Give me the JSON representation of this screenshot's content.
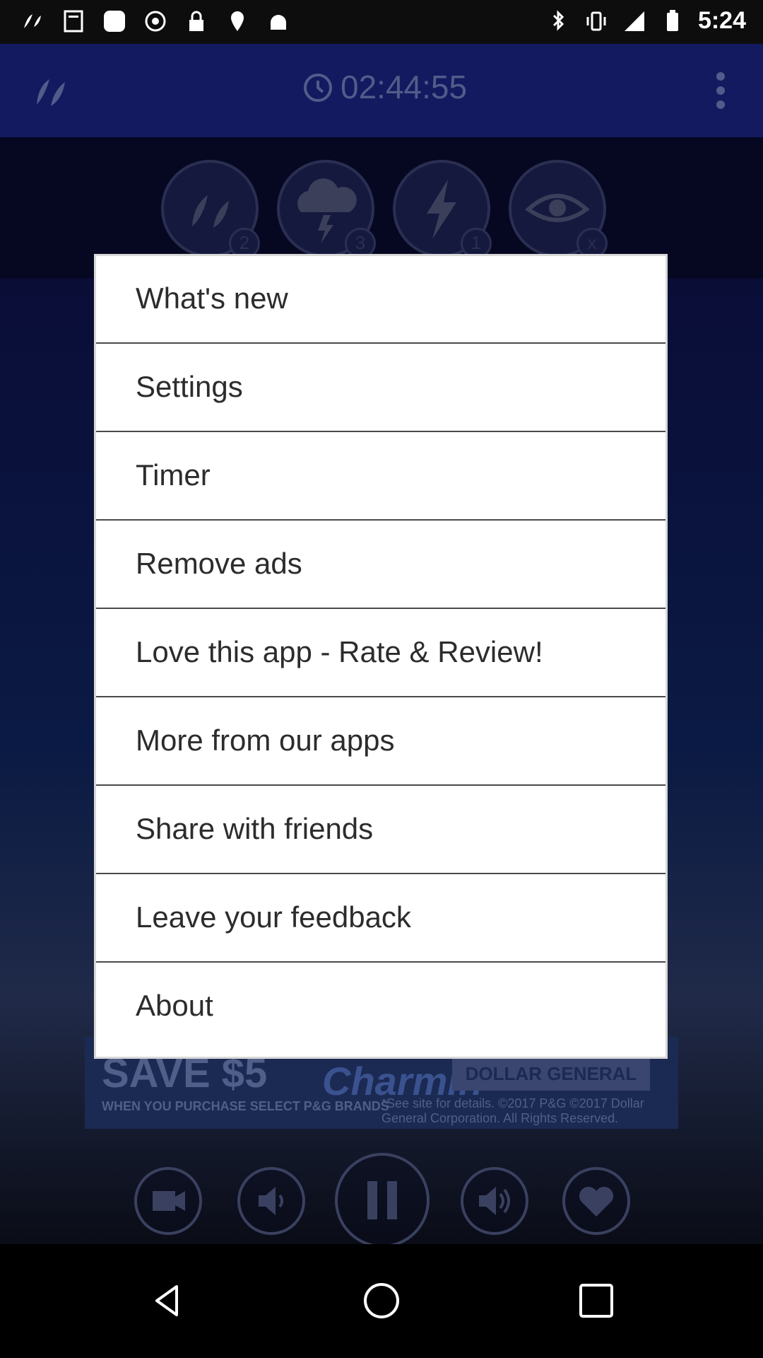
{
  "status_bar": {
    "time": "5:24"
  },
  "app_bar": {
    "timer": "02:44:55"
  },
  "mode_buttons": [
    {
      "icon": "raindrops-icon",
      "badge": "2"
    },
    {
      "icon": "thunder-cloud-icon",
      "badge": "3"
    },
    {
      "icon": "lightning-icon",
      "badge": "1"
    },
    {
      "icon": "eye-icon",
      "badge": "x"
    }
  ],
  "ad": {
    "headline": "SAVE $5",
    "brand": "Charmin",
    "store": "DOLLAR GENERAL",
    "line1": "WHEN YOU PURCHASE SELECT P&G BRANDS",
    "line2": "*See site for details. ©2017 P&G ©2017 Dollar General Corporation. All Rights Reserved."
  },
  "menu": {
    "items": [
      {
        "label": "What's new"
      },
      {
        "label": "Settings"
      },
      {
        "label": "Timer"
      },
      {
        "label": "Remove ads"
      },
      {
        "label": "Love this app - Rate & Review!"
      },
      {
        "label": "More from our apps"
      },
      {
        "label": "Share with friends"
      },
      {
        "label": "Leave your feedback"
      },
      {
        "label": "About"
      }
    ]
  },
  "colors": {
    "app_bar": "#131a5f",
    "menu_background": "#ffffff",
    "menu_text": "#2c2c2c",
    "divider": "#4a4a4a"
  }
}
